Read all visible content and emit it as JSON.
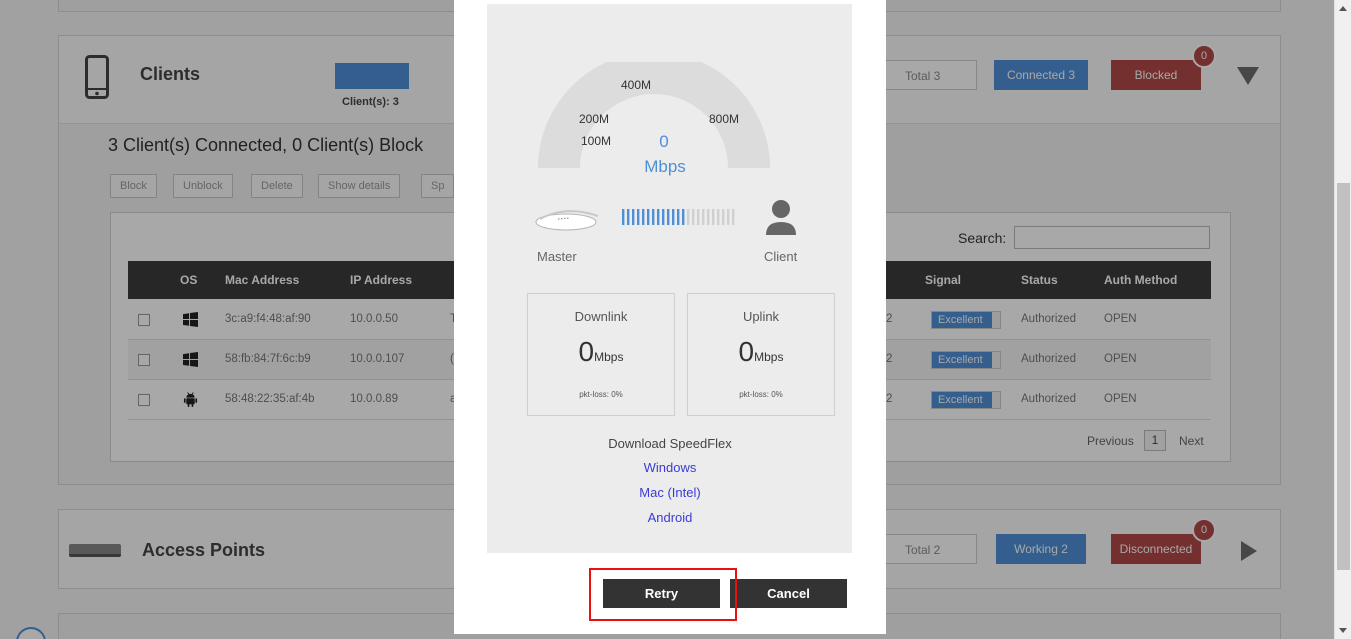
{
  "clients_panel": {
    "title": "Clients",
    "mini_stat": "Client(s): 3",
    "total": "Total 3",
    "connected": "Connected 3",
    "blocked": "Blocked",
    "blocked_count": "0",
    "summary": "3 Client(s) Connected, 0 Client(s) Block",
    "actions": [
      "Block",
      "Unblock",
      "Delete",
      "Show details",
      "Sp"
    ],
    "search_label": "Search:",
    "search_value": "",
    "columns": [
      "OS",
      "Mac Address",
      "IP Address",
      "Signal",
      "Status",
      "Auth Method"
    ],
    "rows": [
      {
        "os": "windows-icon",
        "mac": "3c:a9:f4:48:af:90",
        "ip": "10.0.0.50",
        "hidden_frag": "T",
        "num_frag": "2",
        "signal": "Excellent",
        "status": "Authorized",
        "auth": "OPEN"
      },
      {
        "os": "windows-icon",
        "mac": "58:fb:84:7f:6c:b9",
        "ip": "10.0.0.107",
        "hidden_frag": "(",
        "num_frag": "2",
        "signal": "Excellent",
        "status": "Authorized",
        "auth": "OPEN"
      },
      {
        "os": "android-icon",
        "mac": "58:48:22:35:af:4b",
        "ip": "10.0.0.89",
        "hidden_frag": "a",
        "num_frag": "2",
        "signal": "Excellent",
        "status": "Authorized",
        "auth": "OPEN"
      }
    ],
    "pagination": {
      "previous": "Previous",
      "page": "1",
      "next": "Next"
    }
  },
  "ap_panel": {
    "title": "Access Points",
    "total": "Total 2",
    "working": "Working 2",
    "disconnected": "Disconnected",
    "disconnected_count": "0"
  },
  "speedflex": {
    "gauge_labels": {
      "l100": "100M",
      "l200": "200M",
      "l400": "400M",
      "l800": "800M"
    },
    "gauge_value": "0",
    "gauge_unit": "Mbps",
    "master_label": "Master",
    "client_label": "Client",
    "downlink": {
      "title": "Downlink",
      "value": "0",
      "unit": "Mbps",
      "loss": "pkt-loss: 0%"
    },
    "uplink": {
      "title": "Uplink",
      "value": "0",
      "unit": "Mbps",
      "loss": "pkt-loss: 0%"
    },
    "download_title": "Download SpeedFlex",
    "links": [
      "Windows",
      "Mac (Intel)",
      "Android"
    ],
    "retry": "Retry",
    "cancel": "Cancel",
    "link_color": "#3b3bd6",
    "accent": "#4f8fd6"
  }
}
